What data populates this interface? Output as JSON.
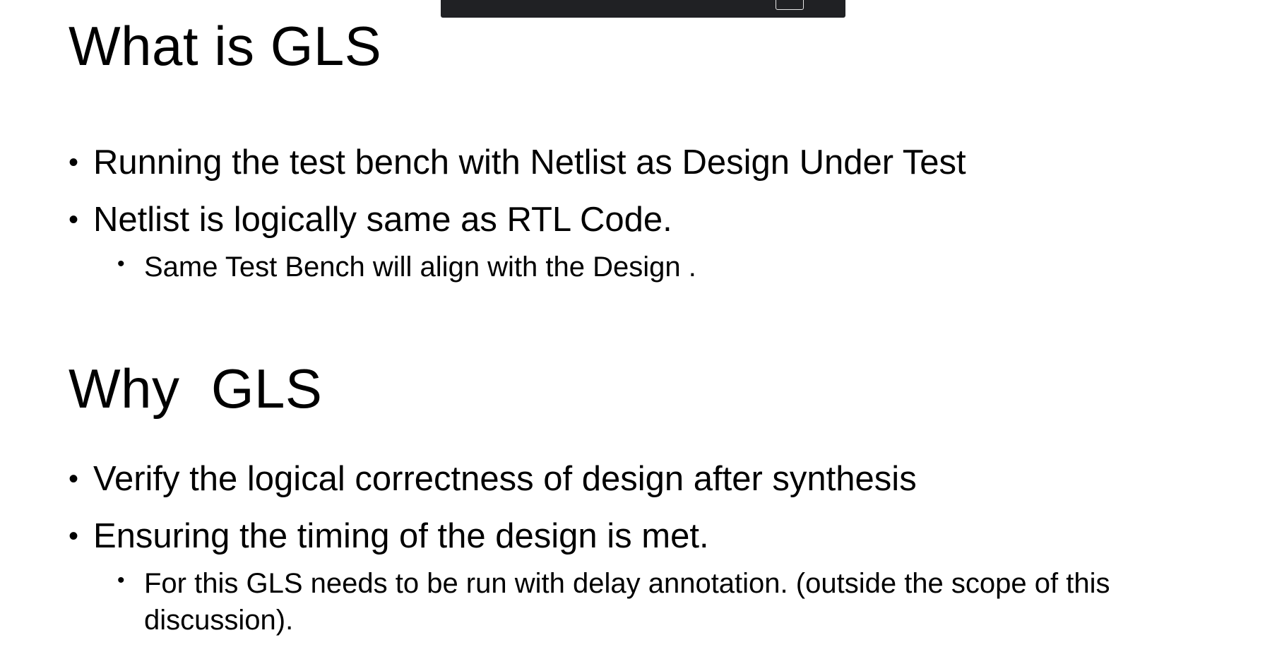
{
  "fullscreen_banner": {
    "text": "",
    "key": ""
  },
  "slide": {
    "section1": {
      "heading": "What is GLS",
      "bullets": [
        "Running the test bench with Netlist as Design Under Test",
        "Netlist is logically same as RTL Code."
      ],
      "sub_bullets": [
        "Same Test Bench will align with the Design ."
      ]
    },
    "section2": {
      "heading": "Why  GLS",
      "bullets": [
        "Verify the logical correctness of design after synthesis",
        "Ensuring the timing of the design is met."
      ],
      "sub_bullets": [
        "For this GLS needs to be run with delay annotation. (outside the scope of this discussion)."
      ]
    },
    "bullet_glyph": "•"
  }
}
